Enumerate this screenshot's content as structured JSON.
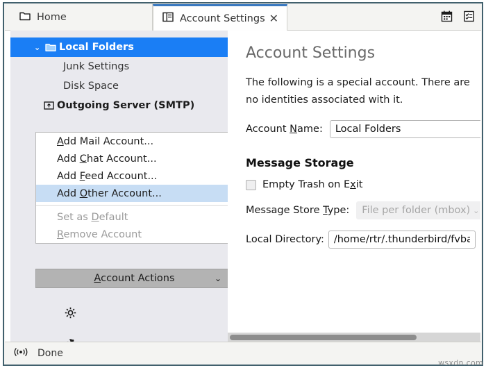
{
  "window": {
    "tabs": [
      {
        "label": "Home",
        "icon": "folder-icon",
        "active": false
      },
      {
        "label": "Account Settings",
        "icon": "account-settings-icon",
        "active": true,
        "close": "✕"
      }
    ],
    "tabstrip_actions": [
      {
        "name": "calendar-icon"
      },
      {
        "name": "tasks-icon"
      }
    ]
  },
  "sidebar": {
    "tree": [
      {
        "label": "Local Folders",
        "icon": "folder-icon",
        "twisty": "⌄",
        "selected": true
      },
      {
        "label": "Junk Settings",
        "selected": false
      },
      {
        "label": "Disk Space",
        "selected": false
      },
      {
        "label": "Outgoing Server (SMTP)",
        "icon": "smtp-server-icon",
        "selected": false
      }
    ],
    "menu": {
      "items": [
        {
          "label": "Add Mail Account...",
          "accel": "A",
          "accel_index": 0,
          "disabled": false,
          "highlight": false
        },
        {
          "label": "Add Chat Account...",
          "accel": "C",
          "accel_index": 4,
          "disabled": false,
          "highlight": false
        },
        {
          "label": "Add Feed Account...",
          "accel": "F",
          "accel_index": 4,
          "disabled": false,
          "highlight": false
        },
        {
          "label": "Add Other Account...",
          "accel": "O",
          "accel_index": 4,
          "disabled": false,
          "highlight": true
        },
        {
          "label": "Set as Default",
          "accel": "D",
          "accel_index": 7,
          "disabled": true,
          "highlight": false
        },
        {
          "label": "Remove Account",
          "accel": "R",
          "accel_index": 0,
          "disabled": true,
          "highlight": false
        }
      ],
      "separator_after_index": 3
    },
    "account_actions": {
      "label": "Account Actions",
      "accel": "A",
      "chevron": "⌄"
    },
    "bottom_icons": [
      {
        "name": "settings-gear-icon"
      },
      {
        "name": "addons-puzzle-icon"
      }
    ]
  },
  "content": {
    "title": "Account Settings",
    "intro": "The following is a special account. There are no identities associated with it.",
    "account_name": {
      "label_before": "Account ",
      "label_accel": "N",
      "label_after": "ame:",
      "value": "Local Folders"
    },
    "message_storage": {
      "heading": "Message Storage",
      "empty_trash": {
        "label_before": "Empty Trash on E",
        "label_accel": "x",
        "label_after": "it",
        "checked": false
      },
      "store_type": {
        "label_before": "Message Store ",
        "label_accel": "T",
        "label_after": "ype:",
        "value": "File per folder (mbox)",
        "chevron": "⌄",
        "disabled": true
      },
      "local_directory": {
        "label": "Local Directory:",
        "value": "/home/rtr/.thunderbird/fvbah"
      }
    }
  },
  "statusbar": {
    "icon": "broadcast-icon",
    "text": "Done"
  },
  "watermark": "wsxdn.com",
  "colors": {
    "selection_blue": "#1a7ef5",
    "menu_highlight": "#c7ddf4",
    "sidebar_bg": "#e9e9ee",
    "window_border": "#41606d",
    "active_tab_accent": "#3a79c0",
    "button_grey": "#b3b3b3"
  }
}
